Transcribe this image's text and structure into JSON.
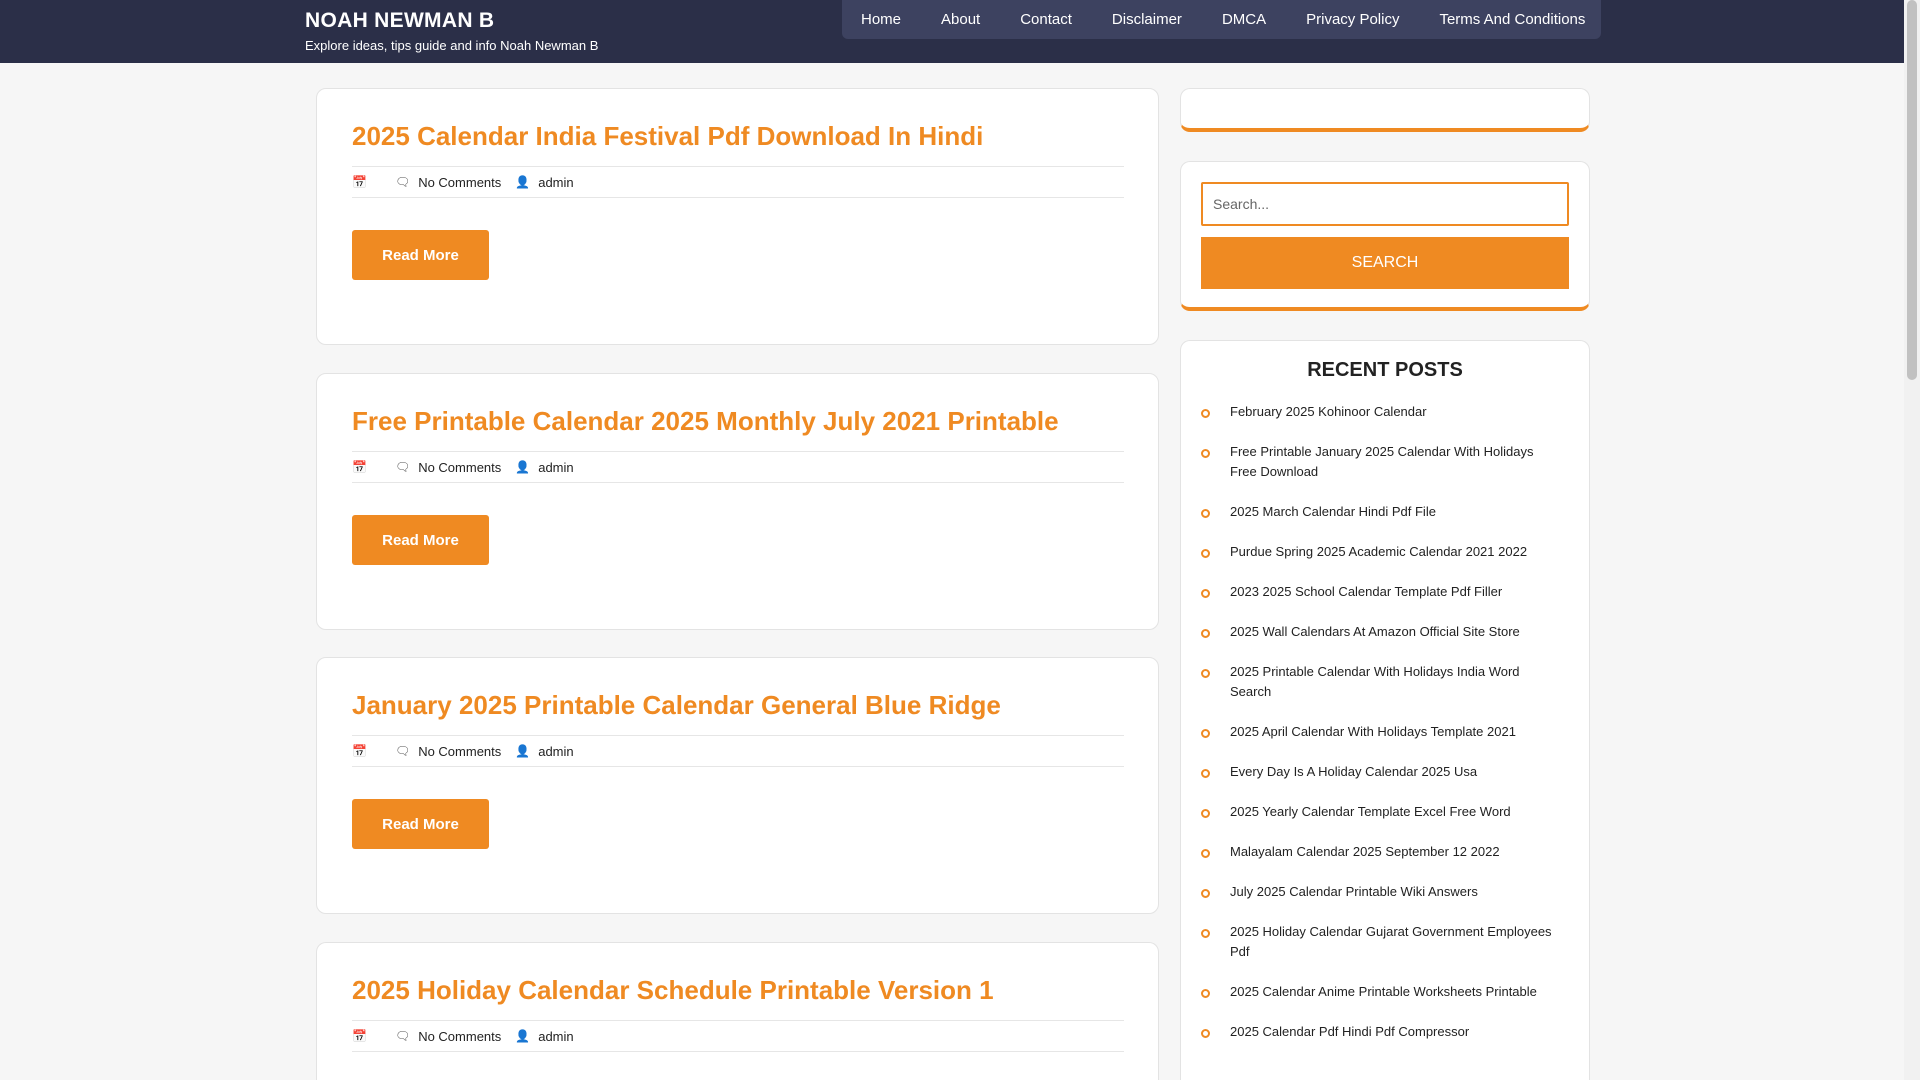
{
  "header": {
    "title": "NOAH NEWMAN B",
    "subtitle": "Explore ideas, tips guide and info Noah Newman B"
  },
  "nav": {
    "items": [
      "Home",
      "About",
      "Contact",
      "Disclaimer",
      "DMCA",
      "Privacy Policy",
      "Terms And Conditions"
    ]
  },
  "posts": [
    {
      "title": "2025 Calendar India Festival Pdf Download In Hindi",
      "comments": "No Comments",
      "author": "admin",
      "button": "Read More"
    },
    {
      "title": "Free Printable Calendar 2025 Monthly July 2021 Printable",
      "comments": "No Comments",
      "author": "admin",
      "button": "Read More"
    },
    {
      "title": "January 2025 Printable Calendar General Blue Ridge",
      "comments": "No Comments",
      "author": "admin",
      "button": "Read More"
    },
    {
      "title": "2025 Holiday Calendar Schedule Printable Version 1",
      "comments": "No Comments",
      "author": "admin",
      "button": "Read More"
    }
  ],
  "search": {
    "placeholder": "Search...",
    "button": "SEARCH"
  },
  "recent": {
    "title": "RECENT POSTS",
    "items": [
      "February 2025 Kohinoor Calendar",
      "Free Printable January 2025 Calendar With Holidays Free Download",
      "2025 March Calendar Hindi Pdf File",
      "Purdue Spring 2025 Academic Calendar 2021 2022",
      "2023 2025 School Calendar Template Pdf Filler",
      "2025 Wall Calendars At Amazon Official Site Store",
      "2025 Printable Calendar With Holidays India Word Search",
      "2025 April Calendar With Holidays Template 2021",
      "Every Day Is A Holiday Calendar 2025 Usa",
      "2025 Yearly Calendar Template Excel Free Word",
      "Malayalam Calendar 2025 September 12 2022",
      "July 2025 Calendar Printable Wiki Answers",
      "2025 Holiday Calendar Gujarat Government Employees Pdf",
      "2025 Calendar Anime Printable Worksheets Printable",
      "2025 Calendar Pdf Hindi Pdf Compressor"
    ]
  },
  "icons": {
    "calendar": "calendar-icon",
    "comment": "comment-icon",
    "user": "user-icon",
    "bullet": "circle-bullet-icon"
  },
  "colors": {
    "header_bg": "#2b2f48",
    "accent": "#ef8a22"
  }
}
